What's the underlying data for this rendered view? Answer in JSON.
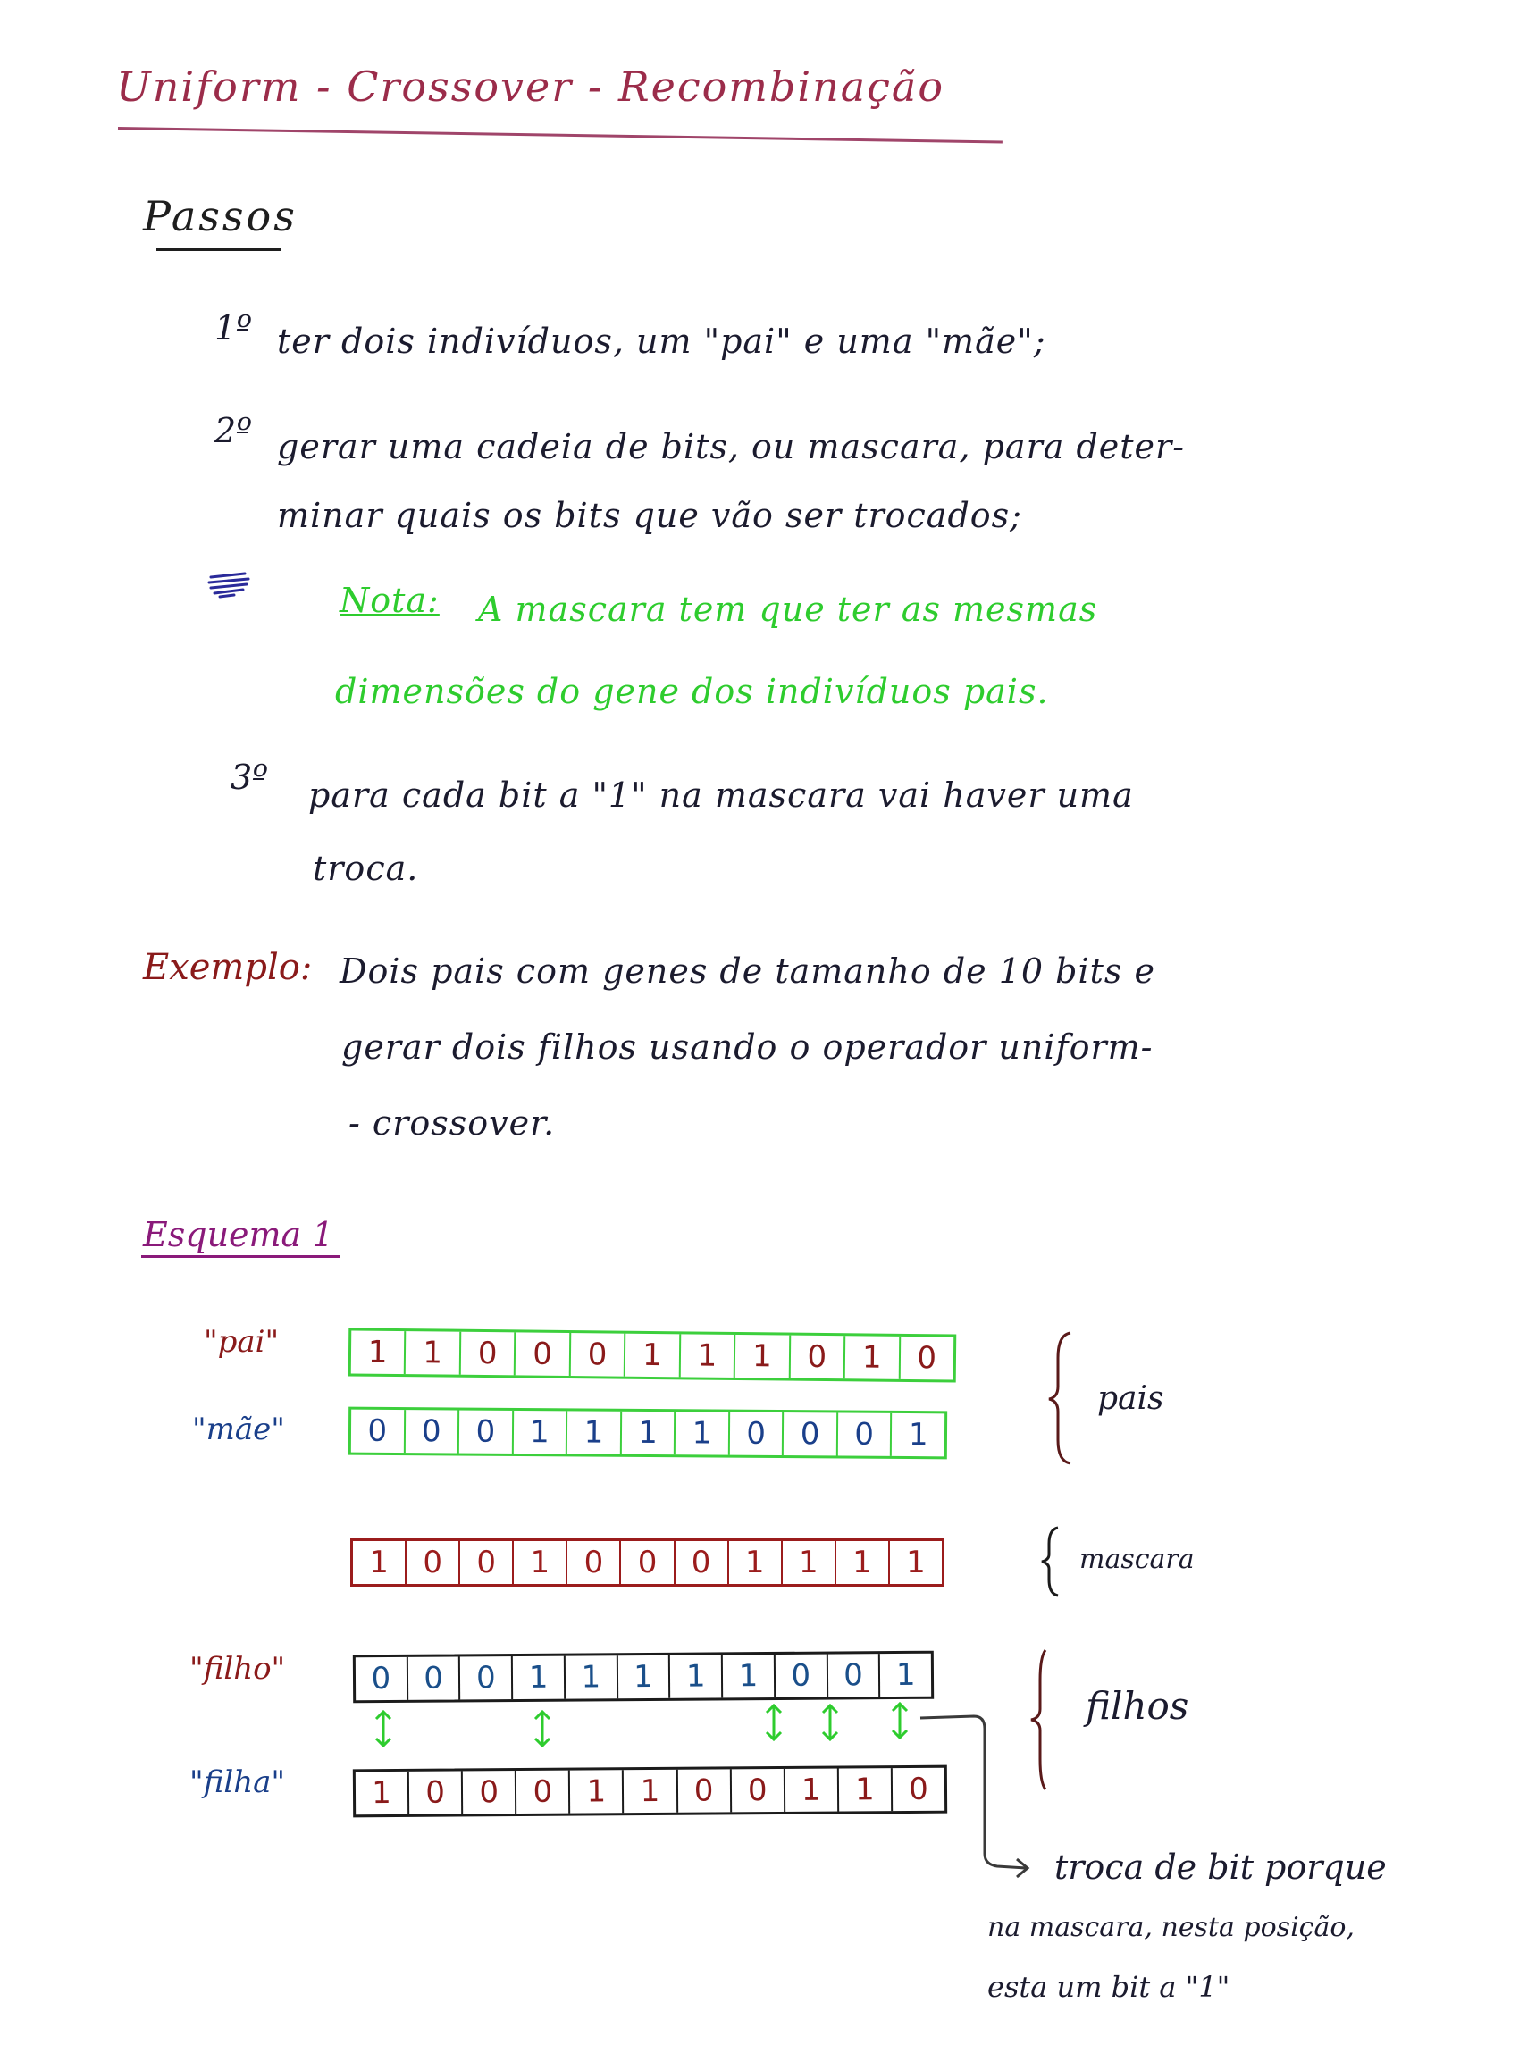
{
  "header": {
    "title": "Uniform - Crossover - Recombinação"
  },
  "section": {
    "title": "Passos"
  },
  "steps": [
    {
      "number": "1º",
      "lines": [
        "ter dois indivíduos, um \"pai\" e uma \"mãe\";"
      ]
    },
    {
      "number": "2º",
      "lines": [
        "gerar uma cadeia de bits, ou mascara, para deter-",
        "minar quais os bits que vão ser trocados;"
      ]
    },
    {
      "number": "3º",
      "lines": [
        "para cada bit a \"1\" na mascara vai haver uma",
        "troca."
      ]
    }
  ],
  "note": {
    "label": "Nota:",
    "lines": [
      "A mascara tem que ter as mesmas",
      "dimensões do gene dos indivíduos pais."
    ]
  },
  "example": {
    "label": "Exemplo:",
    "lines": [
      "Dois pais com genes de tamanho de 10 bits e",
      "gerar dois filhos usando o operador uniform-",
      "- crossover."
    ]
  },
  "scheme": {
    "label": "Esquema 1",
    "rows": {
      "pai": {
        "label": "\"pai\"",
        "bits": [
          "1",
          "1",
          "0",
          "0",
          "0",
          "1",
          "1",
          "1",
          "0",
          "1",
          "0"
        ],
        "color": "#3ccf3c"
      },
      "mae": {
        "label": "\"mãe\"",
        "bits": [
          "0",
          "0",
          "0",
          "1",
          "1",
          "1",
          "1",
          "0",
          "0",
          "0",
          "1"
        ],
        "color": "#3ccf3c"
      },
      "mascara": {
        "bits": [
          "1",
          "0",
          "0",
          "1",
          "0",
          "0",
          "0",
          "1",
          "1",
          "1",
          "1"
        ],
        "color": "#9b1c1c"
      },
      "filho": {
        "label": "\"filho\"",
        "bits": [
          "0",
          "0",
          "0",
          "1",
          "1",
          "1",
          "1",
          "1",
          "0",
          "0",
          "1"
        ],
        "color": "#1b1b1b"
      },
      "filha": {
        "label": "\"filha\"",
        "bits": [
          "1",
          "0",
          "0",
          "0",
          "1",
          "1",
          "0",
          "0",
          "1",
          "1",
          "0"
        ],
        "color": "#1b1b1b"
      }
    },
    "groups": {
      "pais": "pais",
      "mascara": "mascara",
      "filhos": "filhos"
    },
    "annotation": {
      "lines": [
        "troca de bit porque",
        "na mascara, nesta posição,",
        "esta um bit a \"1\""
      ]
    }
  },
  "colors": {
    "title": "#9b2c4a",
    "note": "#2ecc2e",
    "example_label": "#8a1a1a",
    "scheme_label": "#8a1a7a",
    "swap_arrows": "#2ecc2e"
  },
  "icons": [
    "scribble-icon",
    "brace-icon",
    "swap-arrow-icon",
    "curved-arrow-icon"
  ]
}
